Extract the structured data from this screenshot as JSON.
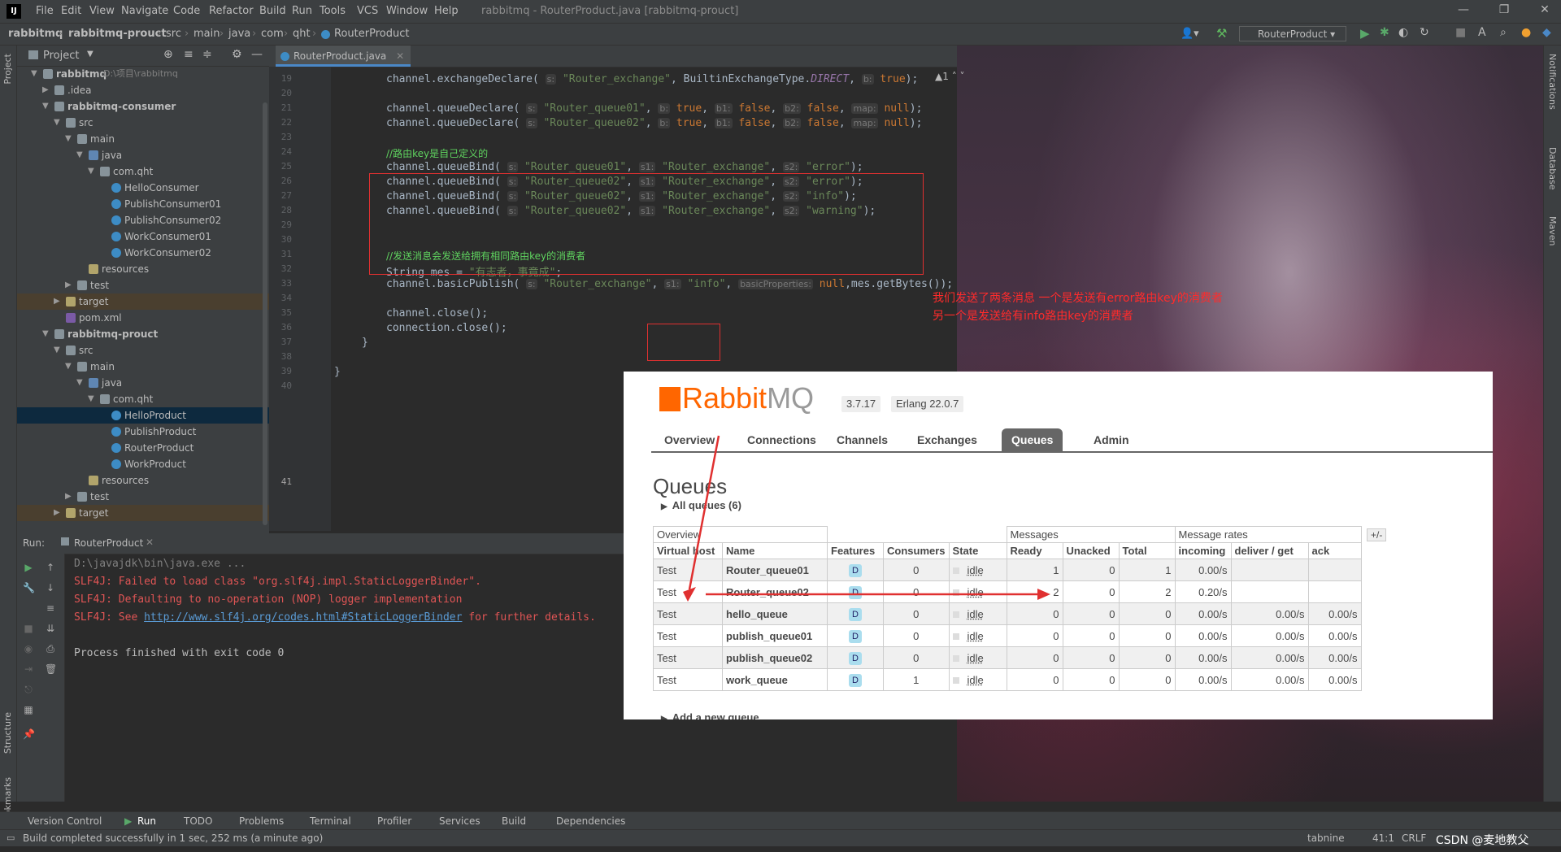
{
  "titlebar": {
    "menu": [
      "File",
      "Edit",
      "View",
      "Navigate",
      "Code",
      "Refactor",
      "Build",
      "Run",
      "Tools",
      "VCS",
      "Window",
      "Help"
    ],
    "title": "rabbitmq - RouterProduct.java [rabbitmq-prouct]"
  },
  "navbar": {
    "crumbs": [
      "rabbitmq",
      "rabbitmq-prouct",
      "src",
      "main",
      "java",
      "com",
      "qht",
      "RouterProduct"
    ],
    "run_config": "RouterProduct"
  },
  "project": {
    "header": "Project",
    "items": [
      {
        "label": "rabbitmq",
        "path": "D:\\项目\\rabbitmq"
      },
      {
        "label": ".idea"
      },
      {
        "label": "rabbitmq-consumer"
      },
      {
        "label": "src"
      },
      {
        "label": "main"
      },
      {
        "label": "java"
      },
      {
        "label": "com.qht"
      },
      {
        "label": "HelloConsumer"
      },
      {
        "label": "PublishConsumer01"
      },
      {
        "label": "PublishConsumer02"
      },
      {
        "label": "WorkConsumer01"
      },
      {
        "label": "WorkConsumer02"
      },
      {
        "label": "resources"
      },
      {
        "label": "test"
      },
      {
        "label": "target"
      },
      {
        "label": "pom.xml"
      },
      {
        "label": "rabbitmq-prouct"
      },
      {
        "label": "src"
      },
      {
        "label": "main"
      },
      {
        "label": "java"
      },
      {
        "label": "com.qht"
      },
      {
        "label": "HelloProduct"
      },
      {
        "label": "PublishProduct"
      },
      {
        "label": "RouterProduct"
      },
      {
        "label": "WorkProduct"
      },
      {
        "label": "resources"
      },
      {
        "label": "test"
      },
      {
        "label": "target"
      }
    ]
  },
  "editor": {
    "tab": "RouterProduct.java",
    "line_numbers": [
      "19",
      "20",
      "21",
      "22",
      "23",
      "24",
      "25",
      "26",
      "27",
      "28",
      "29",
      "30",
      "31",
      "32",
      "33",
      "34",
      "35",
      "36",
      "37",
      "38",
      "39",
      "40",
      "41"
    ],
    "inspection": "▲1"
  },
  "annotation": {
    "line1": "我们发送了两条消息 一个是发送有error路由key的消费者",
    "line2": "另一个是发送给有info路由key的消费者"
  },
  "run": {
    "label": "Run:",
    "tab": "RouterProduct",
    "lines": [
      "D:\\javajdk\\bin\\java.exe ...",
      "SLF4J: Failed to load class \"org.slf4j.impl.StaticLoggerBinder\".",
      "SLF4J: Defaulting to no-operation (NOP) logger implementation",
      "SLF4J: See ",
      "http://www.slf4j.org/codes.html#StaticLoggerBinder",
      " for further details.",
      "Process finished with exit code 0"
    ]
  },
  "toolwindows": [
    "Version Control",
    "Run",
    "TODO",
    "Problems",
    "Terminal",
    "Profiler",
    "Services",
    "Build",
    "Dependencies"
  ],
  "status": {
    "message": "Build completed successfully in 1 sec, 252 ms (a minute ago)",
    "tabnine": "tabnine",
    "position": "41:1",
    "line_sep": "CRLF",
    "watermark": "CSDN @麦地教父"
  },
  "side_labels": {
    "left": [
      "Project",
      "Structure",
      "Bookmarks"
    ],
    "right": [
      "Notifications",
      "Database",
      "Maven"
    ]
  },
  "rabbitmq": {
    "logo_rabbit": "Rabbit",
    "logo_mq": "MQ",
    "version": "3.7.17",
    "erlang": "Erlang 22.0.7",
    "tabs": [
      "Overview",
      "Connections",
      "Channels",
      "Exchanges",
      "Queues",
      "Admin"
    ],
    "active_tab": "Queues",
    "title": "Queues",
    "all_queues": "All queues (6)",
    "group_headers": [
      "Overview",
      "Messages",
      "Message rates"
    ],
    "plus_minus": "+/-",
    "columns": [
      "Virtual host",
      "Name",
      "Features",
      "Consumers",
      "State",
      "Ready",
      "Unacked",
      "Total",
      "incoming",
      "deliver / get",
      "ack"
    ],
    "rows": [
      {
        "vhost": "Test",
        "name": "Router_queue01",
        "feature": "D",
        "consumers": "0",
        "state": "idle",
        "ready": "1",
        "unacked": "0",
        "total": "1",
        "incoming": "0.00/s",
        "deliver": "",
        "ack": ""
      },
      {
        "vhost": "Test",
        "name": "Router_queue02",
        "feature": "D",
        "consumers": "0",
        "state": "idle",
        "ready": "2",
        "unacked": "0",
        "total": "2",
        "incoming": "0.20/s",
        "deliver": "",
        "ack": ""
      },
      {
        "vhost": "Test",
        "name": "hello_queue",
        "feature": "D",
        "consumers": "0",
        "state": "idle",
        "ready": "0",
        "unacked": "0",
        "total": "0",
        "incoming": "0.00/s",
        "deliver": "0.00/s",
        "ack": "0.00/s"
      },
      {
        "vhost": "Test",
        "name": "publish_queue01",
        "feature": "D",
        "consumers": "0",
        "state": "idle",
        "ready": "0",
        "unacked": "0",
        "total": "0",
        "incoming": "0.00/s",
        "deliver": "0.00/s",
        "ack": "0.00/s"
      },
      {
        "vhost": "Test",
        "name": "publish_queue02",
        "feature": "D",
        "consumers": "0",
        "state": "idle",
        "ready": "0",
        "unacked": "0",
        "total": "0",
        "incoming": "0.00/s",
        "deliver": "0.00/s",
        "ack": "0.00/s"
      },
      {
        "vhost": "Test",
        "name": "work_queue",
        "feature": "D",
        "consumers": "1",
        "state": "idle",
        "ready": "0",
        "unacked": "0",
        "total": "0",
        "incoming": "0.00/s",
        "deliver": "0.00/s",
        "ack": "0.00/s"
      }
    ],
    "add_queue": "Add a new queue"
  },
  "colors": {
    "ide_bg": "#2b2b2b",
    "panel_bg": "#3c3f41",
    "annotation_red": "#e03030",
    "rabbit_orange": "#ff6600"
  }
}
